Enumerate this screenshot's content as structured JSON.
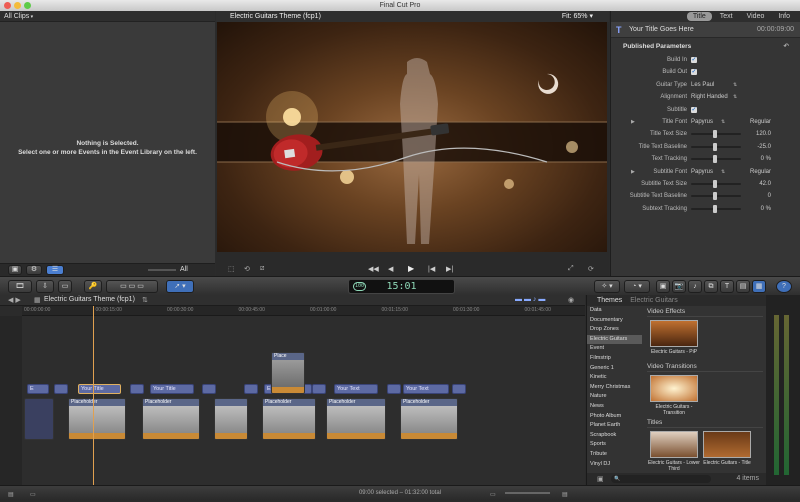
{
  "window": {
    "title": "Final Cut Pro"
  },
  "browser": {
    "header": "All Clips",
    "empty_line1": "Nothing is Selected.",
    "empty_line2": "Select one or more Events in the Event Library on the left.",
    "filter": "All"
  },
  "viewer": {
    "title": "Electric Guitars Theme (fcp1)",
    "fit_label": "Fit:",
    "zoom": "65%"
  },
  "inspector": {
    "tabs": [
      "Title",
      "Text",
      "Video",
      "Info"
    ],
    "active_tab": "Title",
    "title_name": "Your Title Goes Here",
    "title_time": "00:00:09:00",
    "section": "Published Parameters",
    "params": [
      {
        "label": "Build In",
        "type": "check"
      },
      {
        "label": "Build Out",
        "type": "check"
      },
      {
        "label": "Guitar Type",
        "type": "menu",
        "value": "Les Paul"
      },
      {
        "label": "Alignment",
        "type": "menu",
        "value": "Right Handed"
      },
      {
        "label": "Subtitle",
        "type": "check"
      },
      {
        "label": "Title Font",
        "type": "font",
        "value": "Papyrus",
        "style": "Regular"
      },
      {
        "label": "Title Text Size",
        "type": "slider",
        "value": "120.0"
      },
      {
        "label": "Title Text Baseline",
        "type": "slider",
        "value": "-25.0"
      },
      {
        "label": "Text Tracking",
        "type": "slider",
        "value": "0 %"
      },
      {
        "label": "Subtitle Font",
        "type": "font",
        "value": "Papyrus",
        "style": "Regular"
      },
      {
        "label": "Subtitle Text Size",
        "type": "slider",
        "value": "42.0"
      },
      {
        "label": "Subtitle Text Baseline",
        "type": "slider",
        "value": "0"
      },
      {
        "label": "Subtext Tracking",
        "type": "slider",
        "value": "0 %"
      }
    ]
  },
  "toolbar": {
    "timecode_badge": "100",
    "timecode": "15:01"
  },
  "timeline": {
    "project": "Electric Guitars Theme (fcp1)",
    "ruler": [
      "00:00:00:00",
      "00:00:15:00",
      "00:00:30:00",
      "00:00:45:00",
      "00:01:00:00",
      "00:01:15:00",
      "00:01:30:00",
      "00:01:45:00"
    ],
    "title_clips": [
      "E",
      "Your Title",
      "Your Title",
      "E",
      "Your Text",
      "Your Text"
    ],
    "video_clips": [
      "Placeholder",
      "Placeholder",
      "Placeholder",
      "Placeholder",
      "Placeholder"
    ],
    "connected_clip": "Place"
  },
  "themes": {
    "header": "Themes",
    "subheader": "Electric Guitars",
    "list": [
      "Data",
      "Documentary",
      "Drop Zones",
      "Electric Guitars",
      "Event",
      "Filmstrip",
      "Generic 1",
      "Kinetic",
      "Merry Christmas",
      "Nature",
      "News",
      "Photo Album",
      "Planet Earth",
      "Scrapbook",
      "Sports",
      "Tribute",
      "Vinyl DJ"
    ],
    "selected": "Electric Guitars",
    "sections": {
      "effects": "Video Effects",
      "transitions": "Video Transitions",
      "titles": "Titles"
    },
    "items": {
      "pip": "Electric Guitars - PiP",
      "transition": "Electric Guitars - Transition",
      "lower_third": "Electric Guitars - Lower Third",
      "title": "Electric Guitars - Title"
    },
    "count": "4 items"
  },
  "status": {
    "text": "09:00 selected – 01:32:00 total"
  }
}
